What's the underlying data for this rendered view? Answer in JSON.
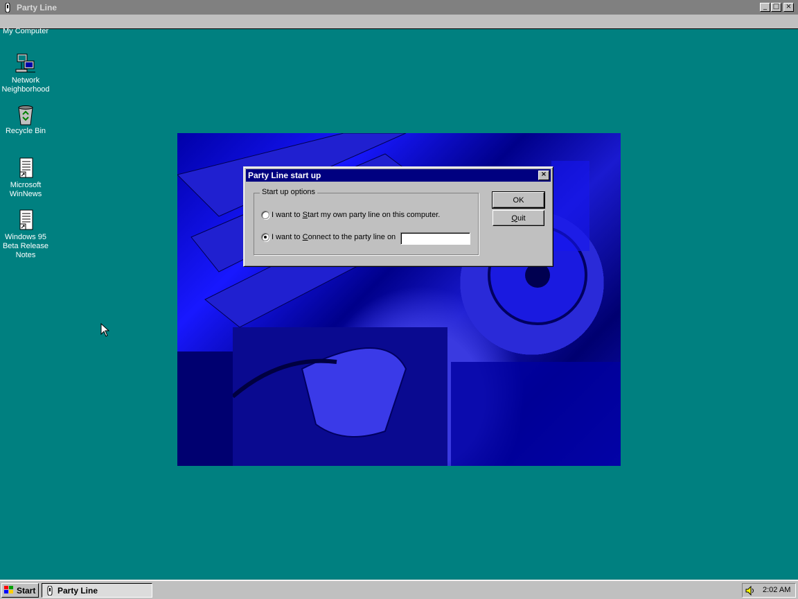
{
  "app_window": {
    "title": "Party Line",
    "controls": {
      "minimize": "_",
      "maximize": "□",
      "close": "×"
    }
  },
  "desktop": {
    "icons": [
      {
        "label": "My Computer",
        "icon": "computer-icon"
      },
      {
        "label": "Network Neighborhood",
        "icon": "network-icon"
      },
      {
        "label": "Recycle Bin",
        "icon": "recycle-bin-icon"
      },
      {
        "label": "Microsoft WinNews",
        "icon": "document-shortcut-icon"
      },
      {
        "label": "Windows 95 Beta Release Notes",
        "icon": "document-shortcut-icon"
      }
    ]
  },
  "dialog": {
    "title": "Party Line start up",
    "close_glyph": "×",
    "group_label": "Start up options",
    "option_start": {
      "prefix": "I want to ",
      "accel": "S",
      "suffix": "tart my own party line on this computer.",
      "selected": false
    },
    "option_connect": {
      "prefix": "I want to ",
      "accel": "C",
      "suffix": "onnect to the party line on",
      "selected": true
    },
    "host_value": "",
    "ok_label": "OK",
    "quit": {
      "accel": "Q",
      "rest": "uit"
    }
  },
  "taskbar": {
    "start_label": "Start",
    "tasks": [
      {
        "label": "Party Line",
        "active": true
      }
    ],
    "clock": "2:02 AM"
  },
  "colors": {
    "desktop": "#008080",
    "title_active": "#000080",
    "title_inactive": "#808080",
    "face": "#c0c0c0"
  }
}
